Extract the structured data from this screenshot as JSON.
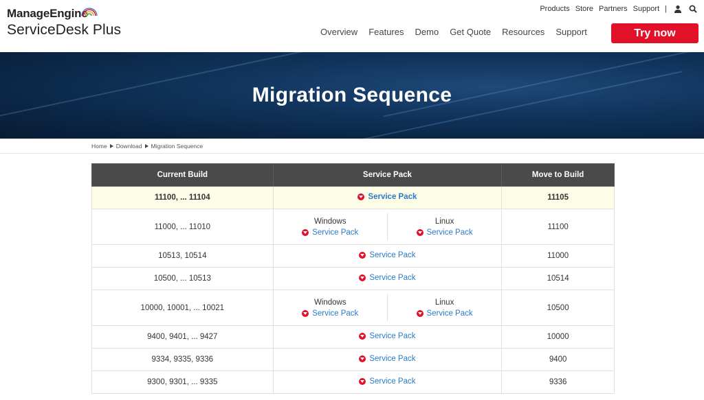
{
  "header": {
    "logo_top": "ManageEngine",
    "logo_bottom": "ServiceDesk Plus",
    "top_links": [
      "Products",
      "Store",
      "Partners",
      "Support"
    ],
    "top_separator": "|",
    "nav": [
      "Overview",
      "Features",
      "Demo",
      "Get Quote",
      "Resources",
      "Support"
    ],
    "cta": "Try now",
    "cta_color": "#e3102a"
  },
  "banner": {
    "title": "Migration Sequence"
  },
  "breadcrumb": [
    "Home",
    "Download",
    "Migration Sequence"
  ],
  "table": {
    "headers": [
      "Current Build",
      "Service Pack",
      "Move to Build"
    ],
    "link_label": "Service Pack",
    "rows": [
      {
        "current": "11100, ... 11104",
        "split": false,
        "move": "11105"
      },
      {
        "current": "11000, ... 11010",
        "split": true,
        "os": [
          "Windows",
          "Linux"
        ],
        "move": "11100"
      },
      {
        "current": "10513, 10514",
        "split": false,
        "move": "11000"
      },
      {
        "current": "10500, ... 10513",
        "split": false,
        "move": "10514"
      },
      {
        "current": "10000, 10001, ... 10021",
        "split": true,
        "os": [
          "Windows",
          "Linux"
        ],
        "move": "10500"
      },
      {
        "current": "9400, 9401, ... 9427",
        "split": false,
        "move": "10000"
      },
      {
        "current": "9334, 9335, 9336",
        "split": false,
        "move": "9400"
      },
      {
        "current": "9300, 9301, ... 9335",
        "split": false,
        "move": "9336"
      }
    ]
  },
  "icons": {
    "user": "user-icon",
    "search": "search-icon",
    "download": "download-icon"
  }
}
